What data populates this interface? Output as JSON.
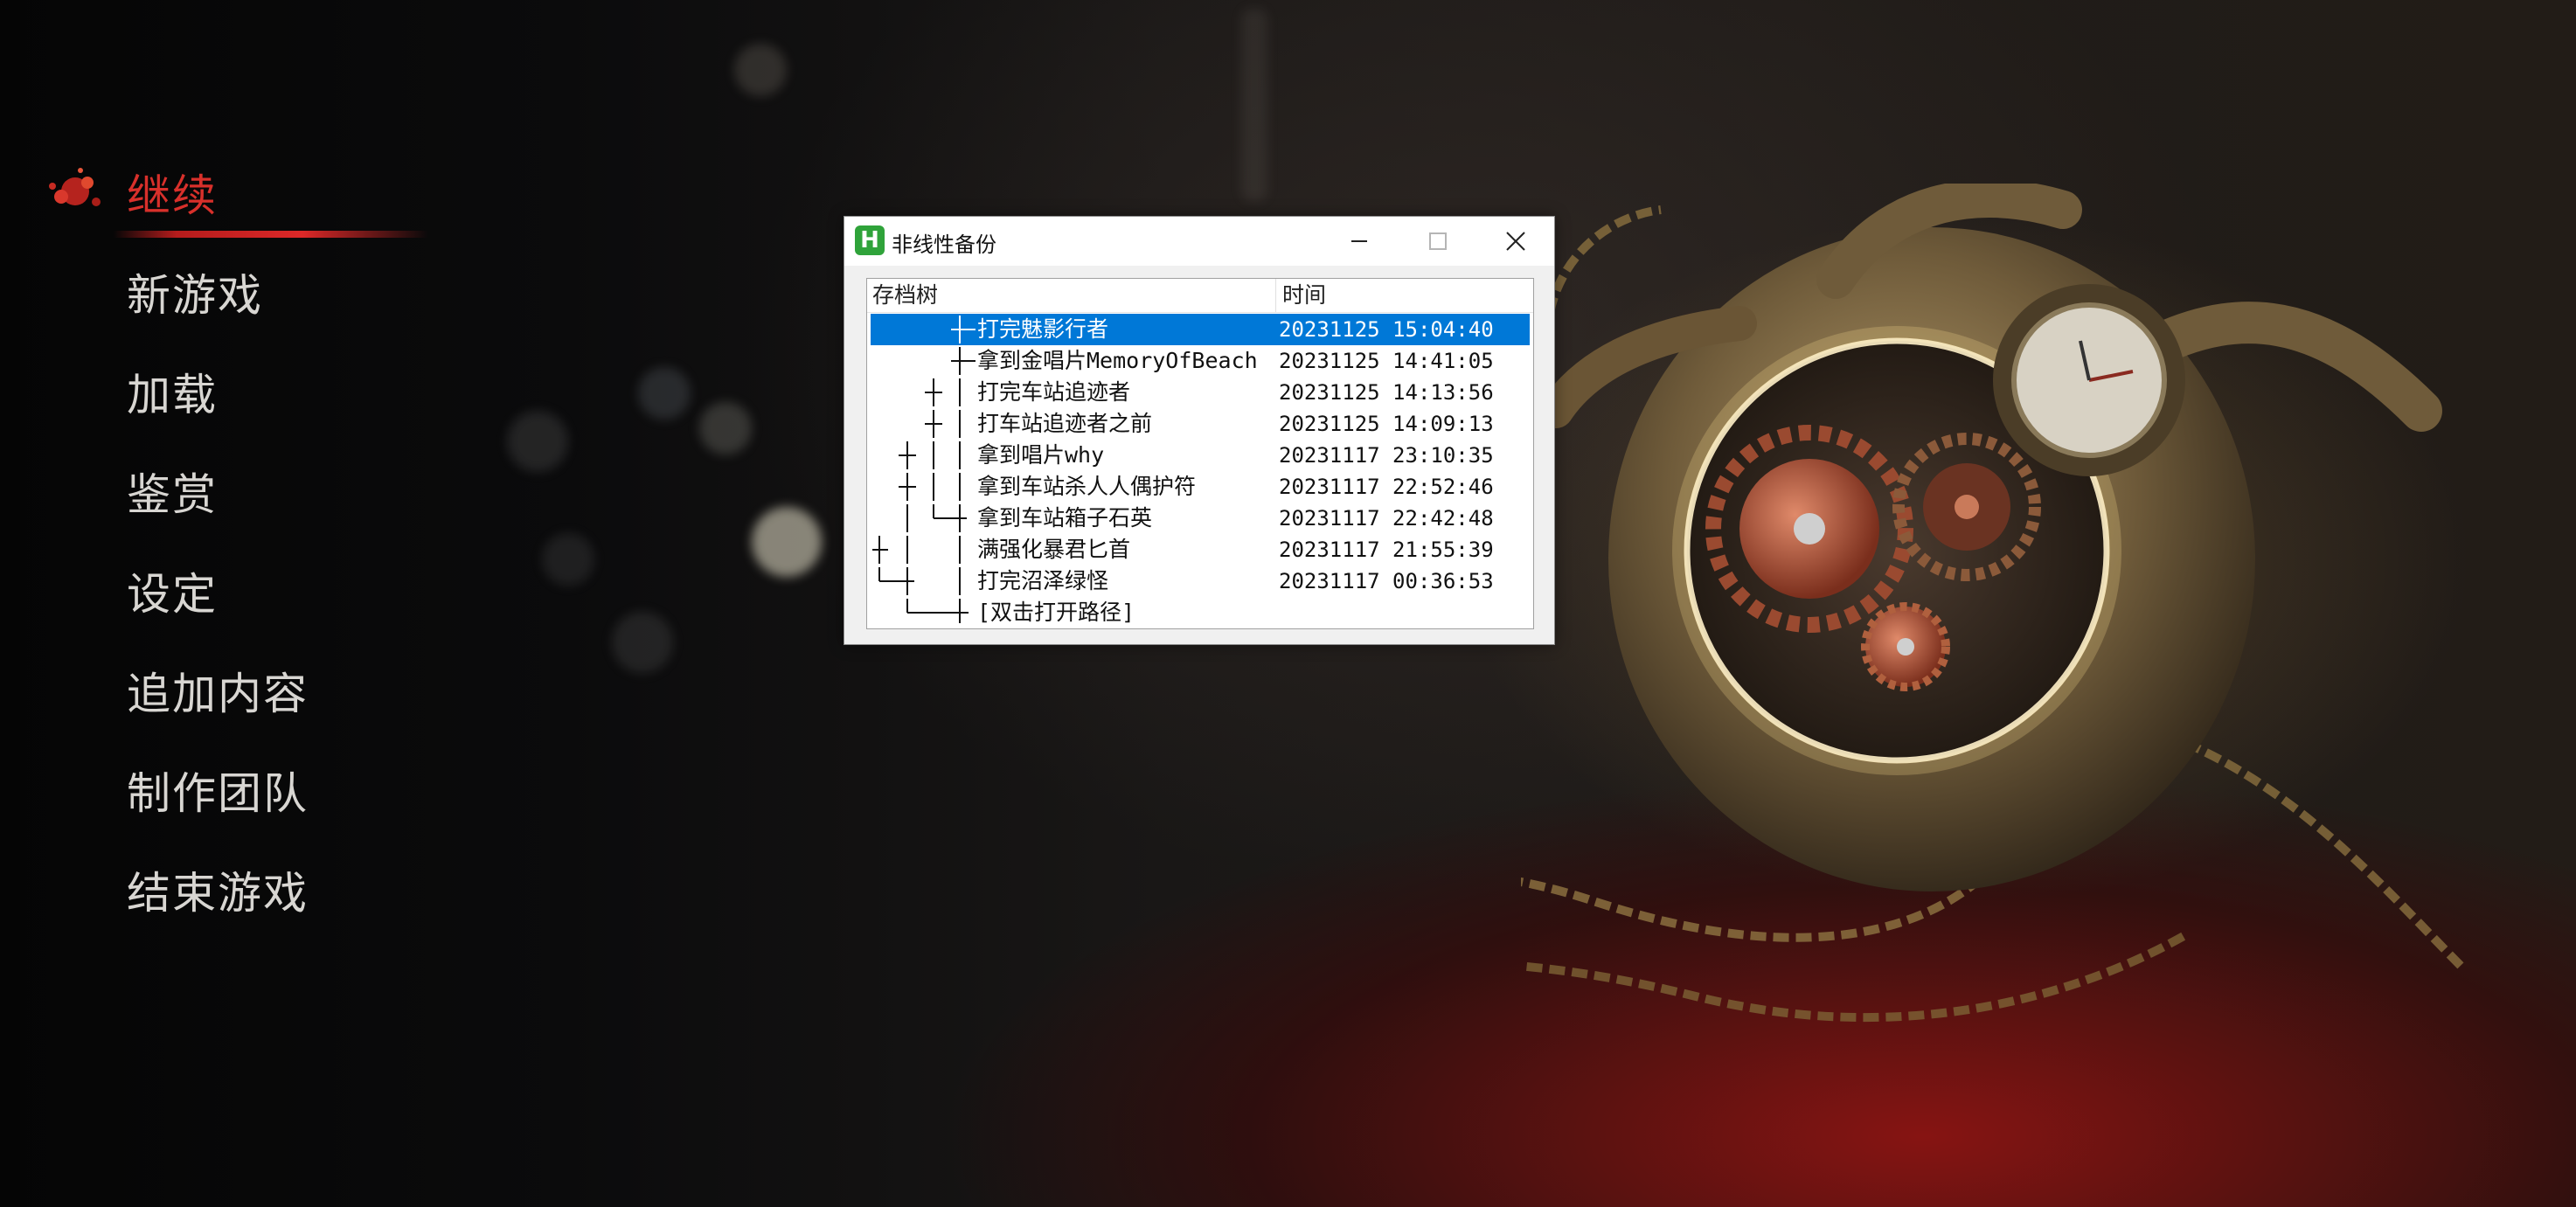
{
  "menu": {
    "items": [
      {
        "label": "继续",
        "active": true
      },
      {
        "label": "新游戏",
        "active": false
      },
      {
        "label": "加载",
        "active": false
      },
      {
        "label": "鉴赏",
        "active": false
      },
      {
        "label": "设定",
        "active": false
      },
      {
        "label": "追加内容",
        "active": false
      },
      {
        "label": "制作团队",
        "active": false
      },
      {
        "label": "结束游戏",
        "active": false
      }
    ],
    "active_color": "#d8302b",
    "text_color": "#d8d6d2"
  },
  "dialog": {
    "title": "非线性备份",
    "app_icon_letter": "H",
    "app_icon_color": "#2fa33a",
    "controls": {
      "minimize": "minimize-icon",
      "maximize": "maximize-icon",
      "close": "close-icon"
    },
    "columns": {
      "tree": "存档树",
      "time": "时间"
    },
    "selected_color": "#0078d7",
    "rows": [
      {
        "name": "打完魅影行者",
        "time": "20231125 15:04:40",
        "selected": true
      },
      {
        "name": "拿到金唱片MemoryOfBeach",
        "time": "20231125 14:41:05",
        "selected": false
      },
      {
        "name": "打完车站追迹者",
        "time": "20231125 14:13:56",
        "selected": false
      },
      {
        "name": "打车站追迹者之前",
        "time": "20231125 14:09:13",
        "selected": false
      },
      {
        "name": "拿到唱片why",
        "time": "20231117 23:10:35",
        "selected": false
      },
      {
        "name": "拿到车站杀人人偶护符",
        "time": "20231117 22:52:46",
        "selected": false
      },
      {
        "name": "拿到车站箱子石英",
        "time": "20231117 22:42:48",
        "selected": false
      },
      {
        "name": "满强化暴君匕首",
        "time": "20231117 21:55:39",
        "selected": false
      },
      {
        "name": "打完沼泽绿怪",
        "time": "20231117 00:36:53",
        "selected": false
      },
      {
        "name": "[双击打开路径]",
        "time": "",
        "selected": false
      }
    ]
  }
}
